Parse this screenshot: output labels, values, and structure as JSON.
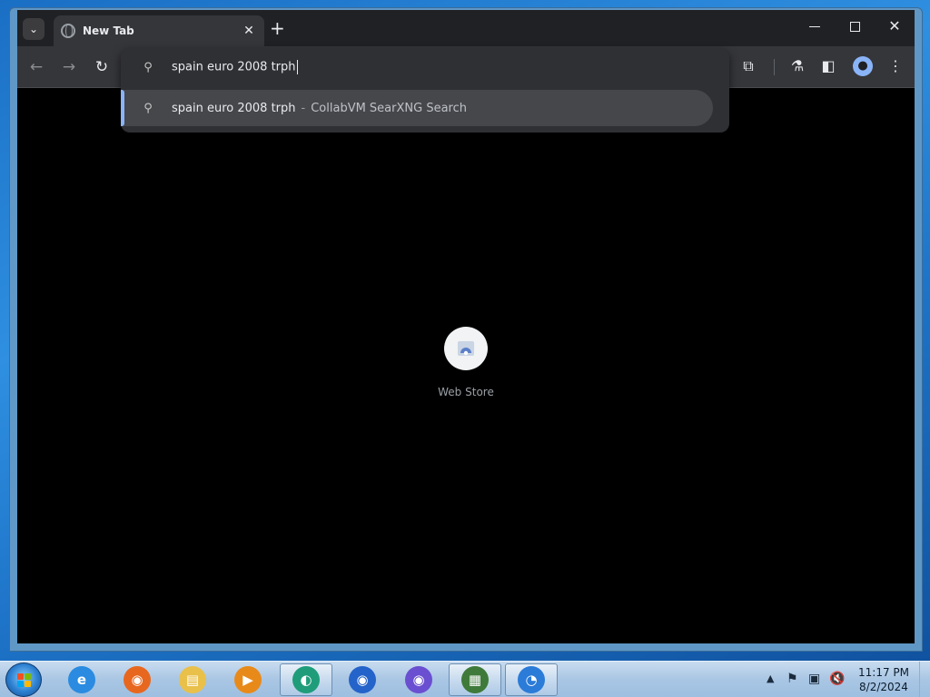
{
  "browser": {
    "tab": {
      "title": "New Tab",
      "close_glyph": "✕"
    },
    "tab_search_glyph": "⌄",
    "new_tab_glyph": "+",
    "window_close_glyph": "✕",
    "nav": {
      "back_glyph": "←",
      "forward_glyph": "→",
      "reload_glyph": "↻"
    },
    "toolbar_right": {
      "extensions_glyph": "⧉",
      "labs_glyph": "⚗",
      "side_panel_glyph": "◧",
      "profile_glyph": "●",
      "menu_glyph": "⋮"
    },
    "omnibox": {
      "search_glyph": "⚲",
      "input_value": "spain euro 2008 trph",
      "suggestion": {
        "text": "spain euro 2008 trph",
        "separator": "-",
        "source": "CollabVM SearXNG Search"
      }
    },
    "shortcuts": [
      {
        "label": "Web Store",
        "icon": "web-store-icon"
      }
    ],
    "colors": {
      "accent": "#8ab4f8",
      "toolbar": "#35363a",
      "tabstrip": "#202124"
    }
  },
  "taskbar": {
    "apps": [
      {
        "name": "internet-explorer-icon",
        "glyph": "e",
        "color": "#2a8be0"
      },
      {
        "name": "firefox-icon",
        "glyph": "◉",
        "color": "#e8671f"
      },
      {
        "name": "file-explorer-icon",
        "glyph": "▤",
        "color": "#e9c04a"
      },
      {
        "name": "media-player-icon",
        "glyph": "▶",
        "color": "#e88a1a"
      },
      {
        "name": "chrome-icon",
        "glyph": "◐",
        "color": "#1f9d7a"
      },
      {
        "name": "firefox-blue-icon",
        "glyph": "◉",
        "color": "#2463c9"
      },
      {
        "name": "firefox-nightly-icon",
        "glyph": "◉",
        "color": "#6a4fd1"
      },
      {
        "name": "task-manager-icon",
        "glyph": "▦",
        "color": "#3f7a3a"
      },
      {
        "name": "remote-desktop-icon",
        "glyph": "◔",
        "color": "#2b7bd8"
      }
    ],
    "tray": {
      "arrow": "▲",
      "flag_glyph": "⚑",
      "network_glyph": "▣",
      "volume_glyph": "🔇"
    },
    "clock": {
      "time": "11:17 PM",
      "date": "8/2/2024"
    }
  }
}
